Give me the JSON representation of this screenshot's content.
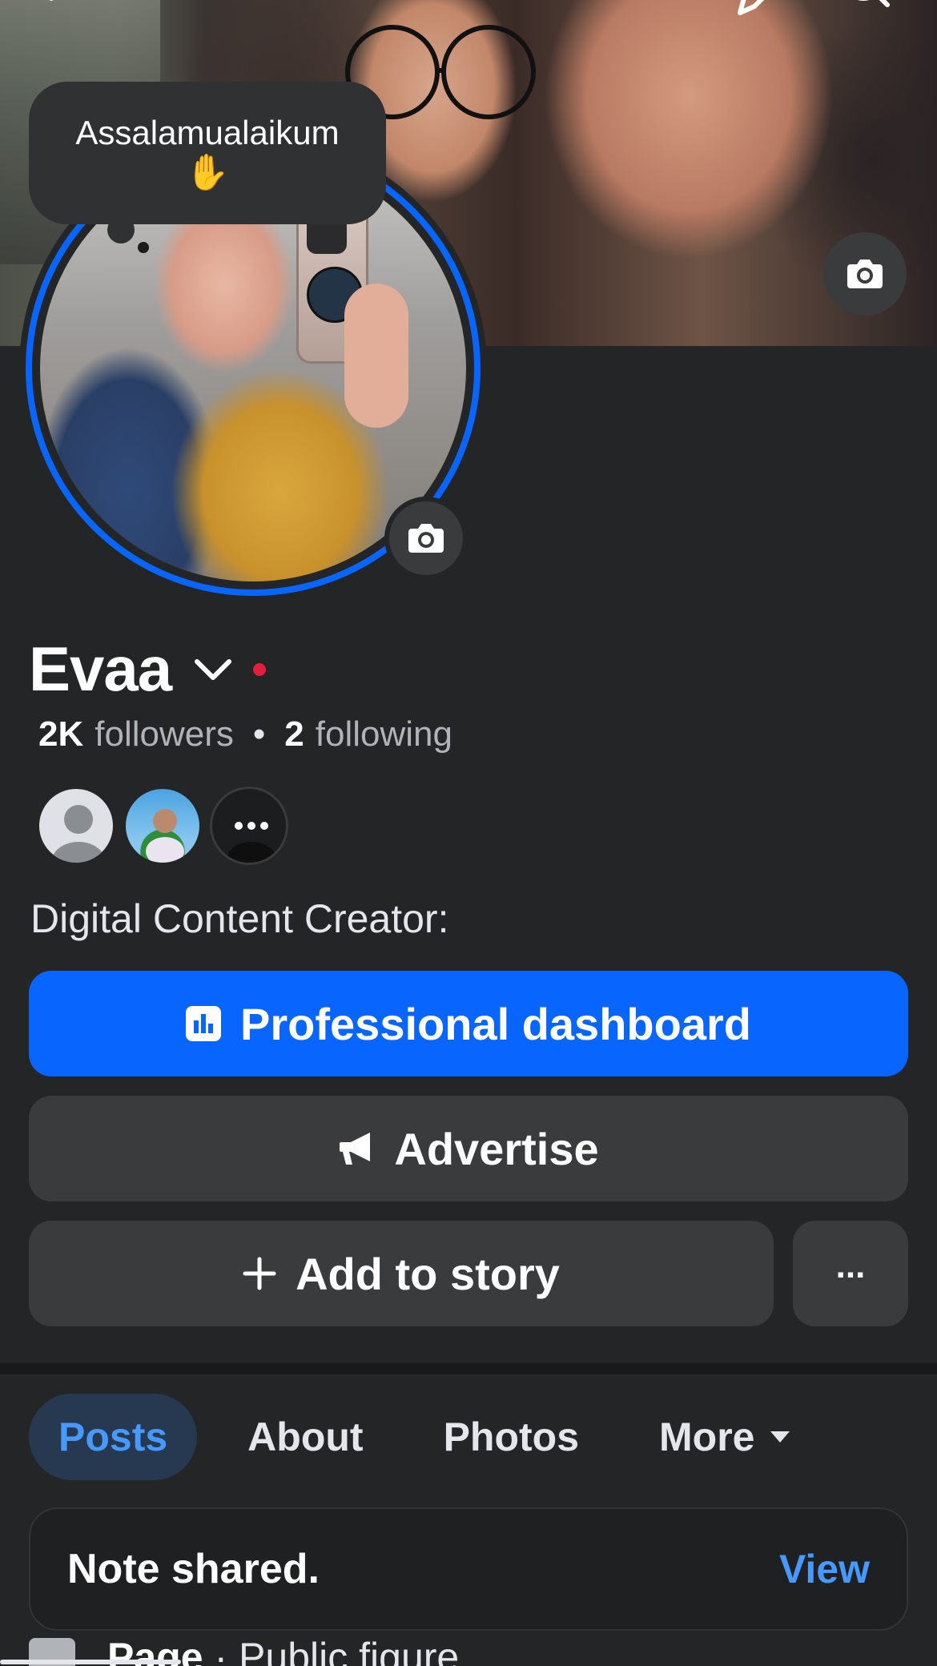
{
  "note": {
    "text": "Assalamualaikum",
    "emoji": "✋"
  },
  "profile": {
    "name": "Evaa",
    "followers_count": "2K",
    "followers_label": "followers",
    "following_count": "2",
    "following_label": "following",
    "separator": "•",
    "bio": "Digital Content Creator:"
  },
  "mutuals": {
    "more_label": "..."
  },
  "buttons": {
    "dashboard": "Professional dashboard",
    "advertise": "Advertise",
    "add_story": "Add to story",
    "more": "..."
  },
  "tabs": [
    {
      "label": "Posts"
    },
    {
      "label": "About"
    },
    {
      "label": "Photos"
    },
    {
      "label": "More"
    }
  ],
  "card": {
    "title": "Note shared.",
    "link": "View"
  },
  "peek": {
    "bold": "Page",
    "text": "· Public figure"
  },
  "colors": {
    "accent": "#0866ff",
    "link": "#4599ff",
    "live_dot": "#e41e3f",
    "background": "#242526"
  },
  "icons": [
    "back-arrow-icon",
    "edit-pencil-icon",
    "search-icon",
    "camera-icon",
    "chevron-down-icon",
    "dashboard-chart-icon",
    "megaphone-icon",
    "plus-icon",
    "more-dots-icon",
    "caret-down-icon",
    "page-icon"
  ]
}
